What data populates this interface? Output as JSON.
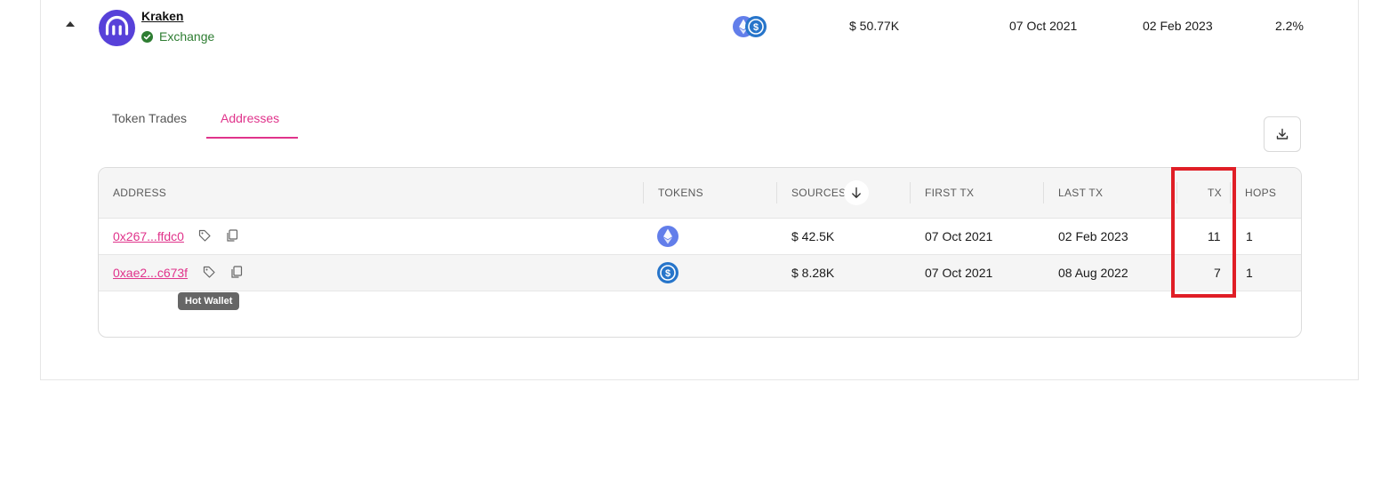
{
  "entity": {
    "name": "Kraken",
    "type": "Exchange",
    "sources": "$ 50.77K",
    "first_tx": "07 Oct 2021",
    "last_tx": "02 Feb 2023",
    "percent": "2.2%",
    "token_icons": [
      "ethereum-icon",
      "usdc-icon"
    ]
  },
  "tabs": [
    {
      "label": "Token Trades",
      "active": false
    },
    {
      "label": "Addresses",
      "active": true
    }
  ],
  "table": {
    "headers": {
      "address": "ADDRESS",
      "tokens": "TOKENS",
      "sources": "SOURCES",
      "first_tx": "FIRST TX",
      "last_tx": "LAST TX",
      "tx": "TX",
      "hops": "HOPS"
    },
    "rows": [
      {
        "address": "0x267...ffdc0",
        "token": "ethereum-icon",
        "sources": "$ 42.5K",
        "first_tx": "07 Oct 2021",
        "last_tx": "02 Feb 2023",
        "tx": "11",
        "hops": "1"
      },
      {
        "address": "0xae2...c673f",
        "token": "usdc-icon",
        "sources": "$ 8.28K",
        "first_tx": "07 Oct 2021",
        "last_tx": "08 Aug 2022",
        "tx": "7",
        "hops": "1"
      }
    ]
  },
  "tooltip": "Hot Wallet",
  "colors": {
    "accent": "#e0338b",
    "kraken": "#5741d9",
    "ethereum": "#627eea",
    "usdc": "#2775ca",
    "verified": "#2e7d32",
    "highlight": "#e01e26"
  }
}
